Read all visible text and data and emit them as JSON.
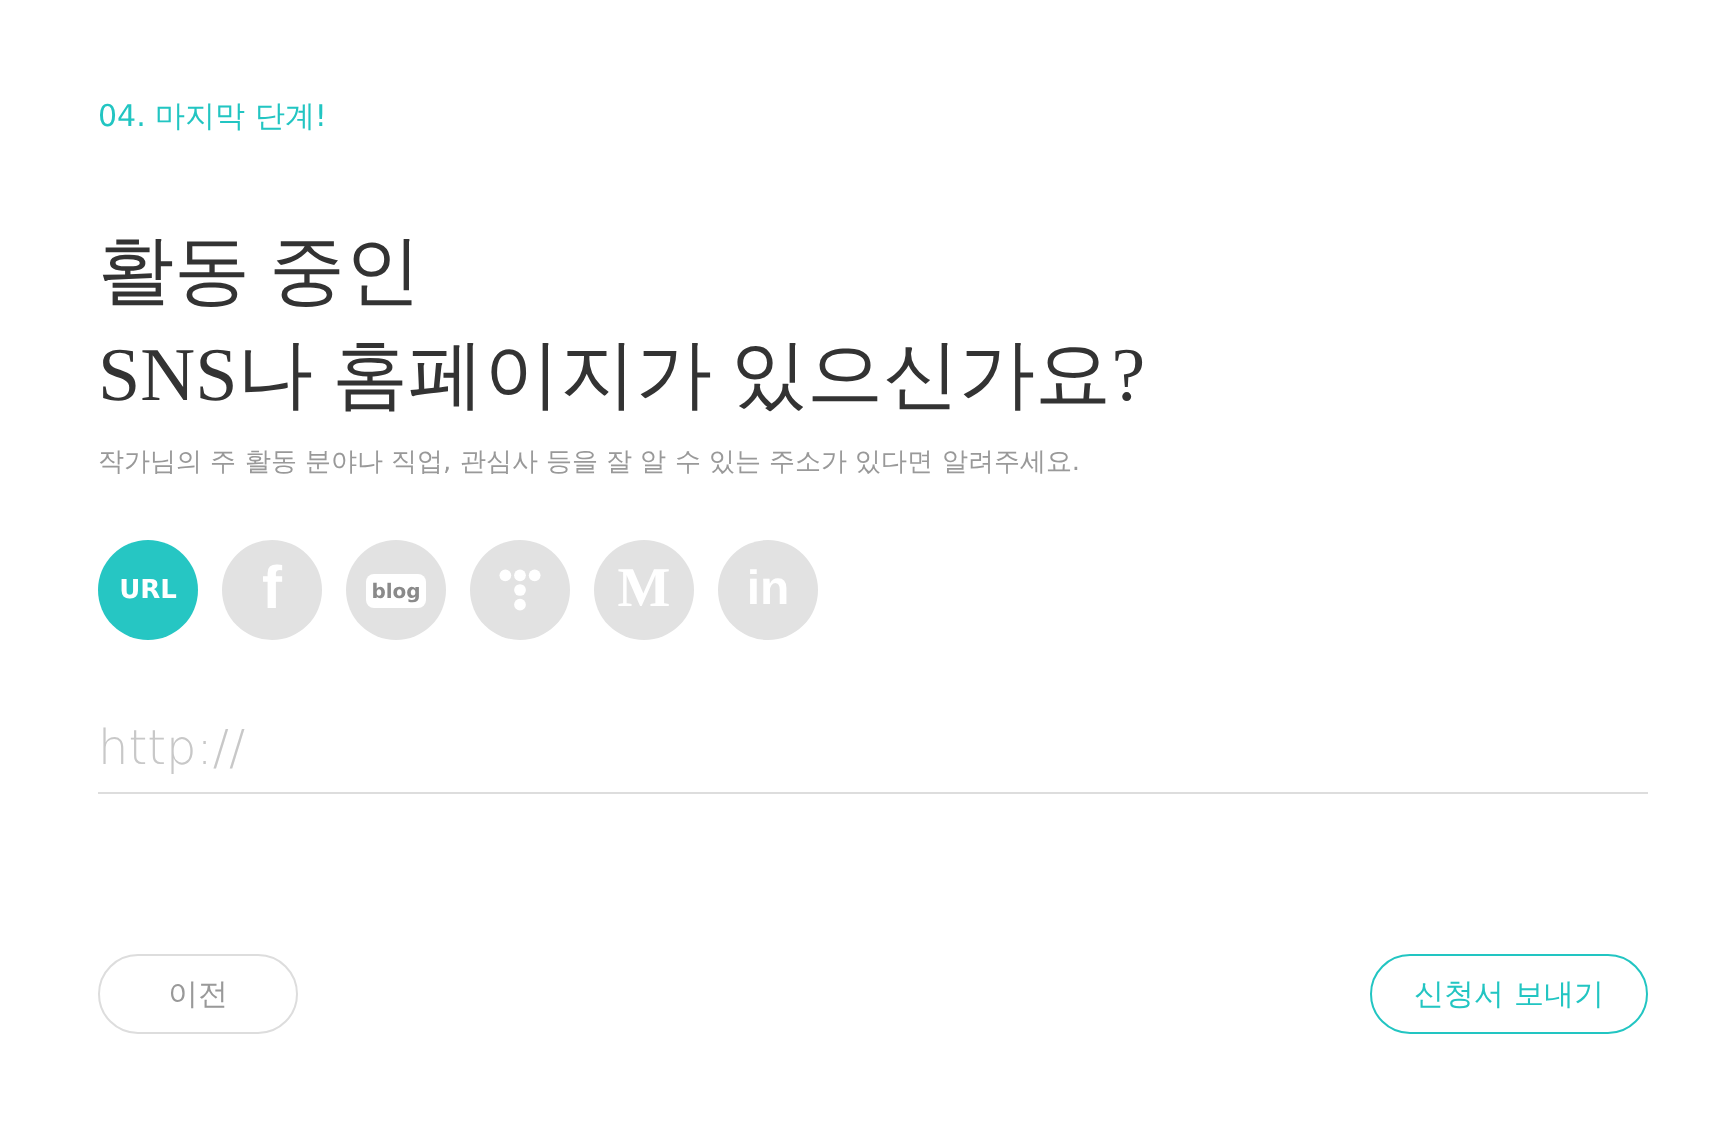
{
  "step": "04. 마지막 단계!",
  "title_lines": [
    "활동 중인",
    "SNS나 홈페이지가 있으신가요?"
  ],
  "description": "작가님의 주 활동 분야나 직업, 관심사 등을 잘 알 수 있는 주소가 있다면 알려주세요.",
  "link_types": [
    {
      "kind": "url",
      "label": "URL",
      "selected": true
    },
    {
      "kind": "facebook",
      "label": "f",
      "selected": false
    },
    {
      "kind": "blog",
      "label": "blog",
      "selected": false
    },
    {
      "kind": "dots",
      "selected": false
    },
    {
      "kind": "medium",
      "label": "M",
      "selected": false
    },
    {
      "kind": "linkedin",
      "label": "in",
      "selected": false
    }
  ],
  "address_field": {
    "placeholder": "http://"
  },
  "buttons": [
    {
      "kind": "back",
      "label": "이전"
    },
    {
      "kind": "submit",
      "label": "신청서 보내기"
    }
  ]
}
